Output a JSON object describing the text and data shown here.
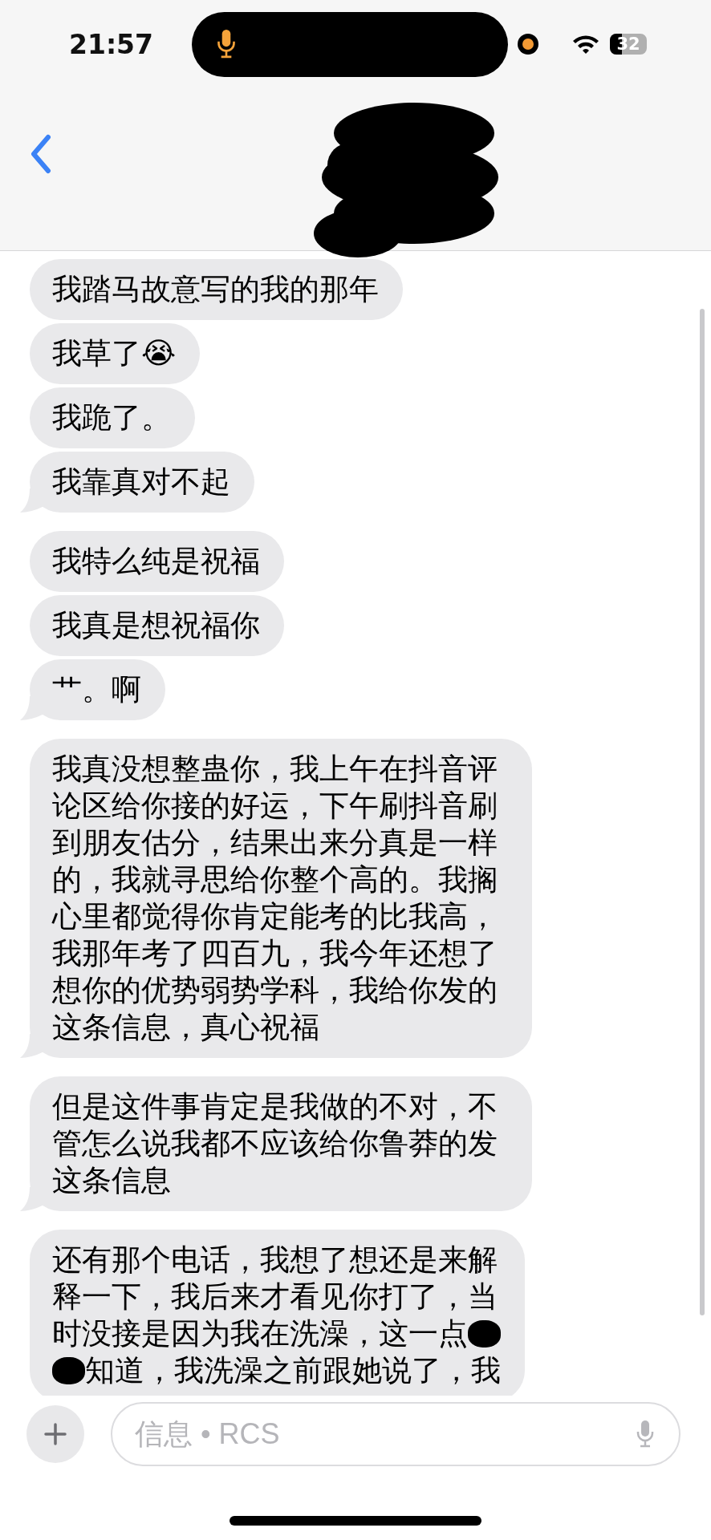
{
  "status_bar": {
    "time": "21:57",
    "battery": "32"
  },
  "messages": [
    {
      "kind": "text",
      "text": "我踏马故意写的我的那年",
      "tail": false
    },
    {
      "kind": "text",
      "text": "我草了😭",
      "tail": false
    },
    {
      "kind": "text",
      "text": "我跪了。",
      "tail": false
    },
    {
      "kind": "text",
      "text": "我靠真对不起",
      "tail": true
    },
    {
      "kind": "text",
      "text": "我特么纯是祝福",
      "tail": false
    },
    {
      "kind": "text",
      "text": "我真是想祝福你",
      "tail": false
    },
    {
      "kind": "text",
      "text": "艹。啊",
      "tail": true
    },
    {
      "kind": "text",
      "text": "我真没想整蛊你，我上午在抖音评论区给你接的好运，下午刷抖音刷到朋友估分，结果出来分真是一样的，我就寻思给你整个高的。我搁心里都觉得你肯定能考的比我高，我那年考了四百九，我今年还想了想你的优势弱势学科，我给你发的这条信息，真心祝福",
      "tail": true
    },
    {
      "kind": "text",
      "text": "但是这件事肯定是我做的不对，不管怎么说我都不应该给你鲁莽的发这条信息",
      "tail": true
    },
    {
      "kind": "lines",
      "lines": [
        {
          "text": "还有那个电话，我想了想还是来解",
          "redacted_before": false,
          "redacted_after": false
        },
        {
          "text": "释一下，我后来才看见你打了，当",
          "redacted_before": false,
          "redacted_after": false
        },
        {
          "text": "时没接是因为我在洗澡，这一点",
          "redacted_before": false,
          "redacted_after": true
        },
        {
          "text": "知道，我洗澡之前跟她说了，我",
          "redacted_before": true,
          "redacted_after": false
        }
      ],
      "tail": false
    }
  ],
  "composer": {
    "placeholder": "信息 • RCS"
  }
}
